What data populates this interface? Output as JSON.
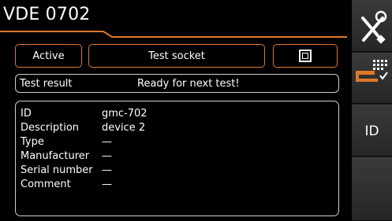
{
  "title": "VDE 0702",
  "controls": {
    "active_label": "Active",
    "socket_label": "Test socket"
  },
  "result": {
    "label": "Test result",
    "message": "Ready for next test!"
  },
  "device_info": [
    {
      "key": "ID",
      "value": "gmc-702"
    },
    {
      "key": "Description",
      "value": "device 2"
    },
    {
      "key": "Type",
      "value": "—"
    },
    {
      "key": "Manufacturer",
      "value": "—"
    },
    {
      "key": "Serial number",
      "value": "—"
    },
    {
      "key": "Comment",
      "value": "—"
    }
  ],
  "sidebar": {
    "id_label": "ID",
    "icons": [
      "tools-icon",
      "checklist-transfer-icon"
    ]
  },
  "colors": {
    "accent": "#e0782a",
    "background": "#000000",
    "sidebar": "#2b2b2b"
  }
}
